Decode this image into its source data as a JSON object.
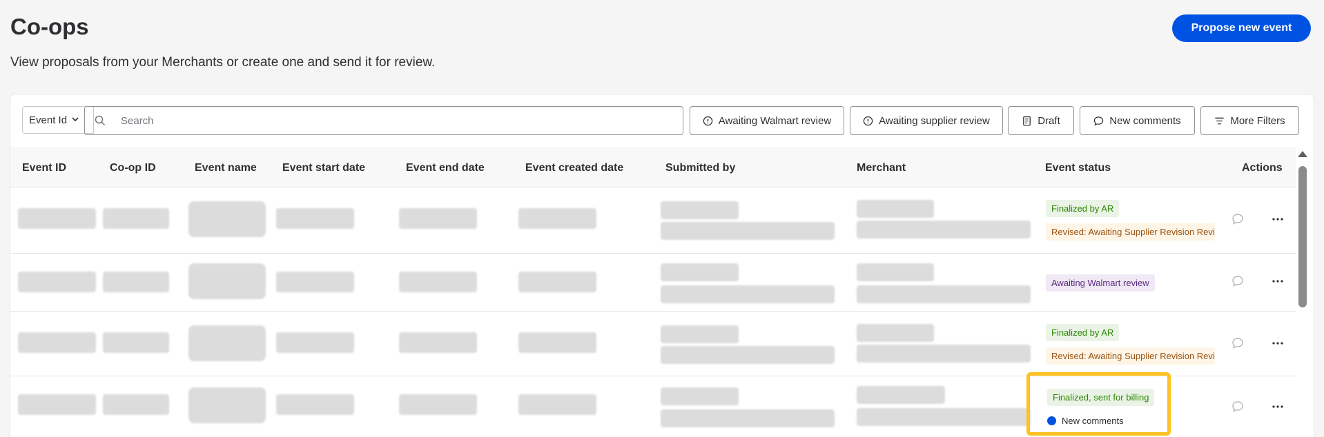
{
  "header": {
    "title": "Co-ops",
    "subtitle": "View proposals from your Merchants or create one and send it for review.",
    "propose_button": "Propose new event"
  },
  "toolbar": {
    "search_field_select": "Event Id",
    "search_placeholder": "Search",
    "filters": {
      "awaiting_walmart": "Awaiting Walmart review",
      "awaiting_supplier": "Awaiting supplier review",
      "draft": "Draft",
      "new_comments": "New comments",
      "more_filters": "More Filters"
    }
  },
  "table": {
    "columns": {
      "event_id": "Event ID",
      "coop_id": "Co-op ID",
      "event_name": "Event name",
      "start_date": "Event start date",
      "end_date": "Event end date",
      "created_date": "Event created date",
      "submitted_by": "Submitted by",
      "merchant": "Merchant",
      "status": "Event status",
      "actions": "Actions"
    },
    "rows": [
      {
        "status_1": "Finalized by AR",
        "status_2": "Revised: Awaiting Supplier Revision Review"
      },
      {
        "status_1": "Awaiting Walmart review"
      },
      {
        "status_1": "Finalized by AR",
        "status_2": "Revised: Awaiting Supplier Revision Review"
      },
      {
        "status_1": "Finalized, sent for billing",
        "comment_note": "New comments"
      }
    ]
  },
  "colors": {
    "primary": "#0053e2",
    "highlight": "#ffc220",
    "status_green": "#2a8703",
    "status_orange": "#995213",
    "status_purple": "#5a2a82"
  },
  "icons": [
    "search-icon",
    "info-circle-icon",
    "draft-icon",
    "comment-icon",
    "filter-lines-icon",
    "chevron-down-icon",
    "comment-bubble-icon",
    "more-dots-icon"
  ]
}
